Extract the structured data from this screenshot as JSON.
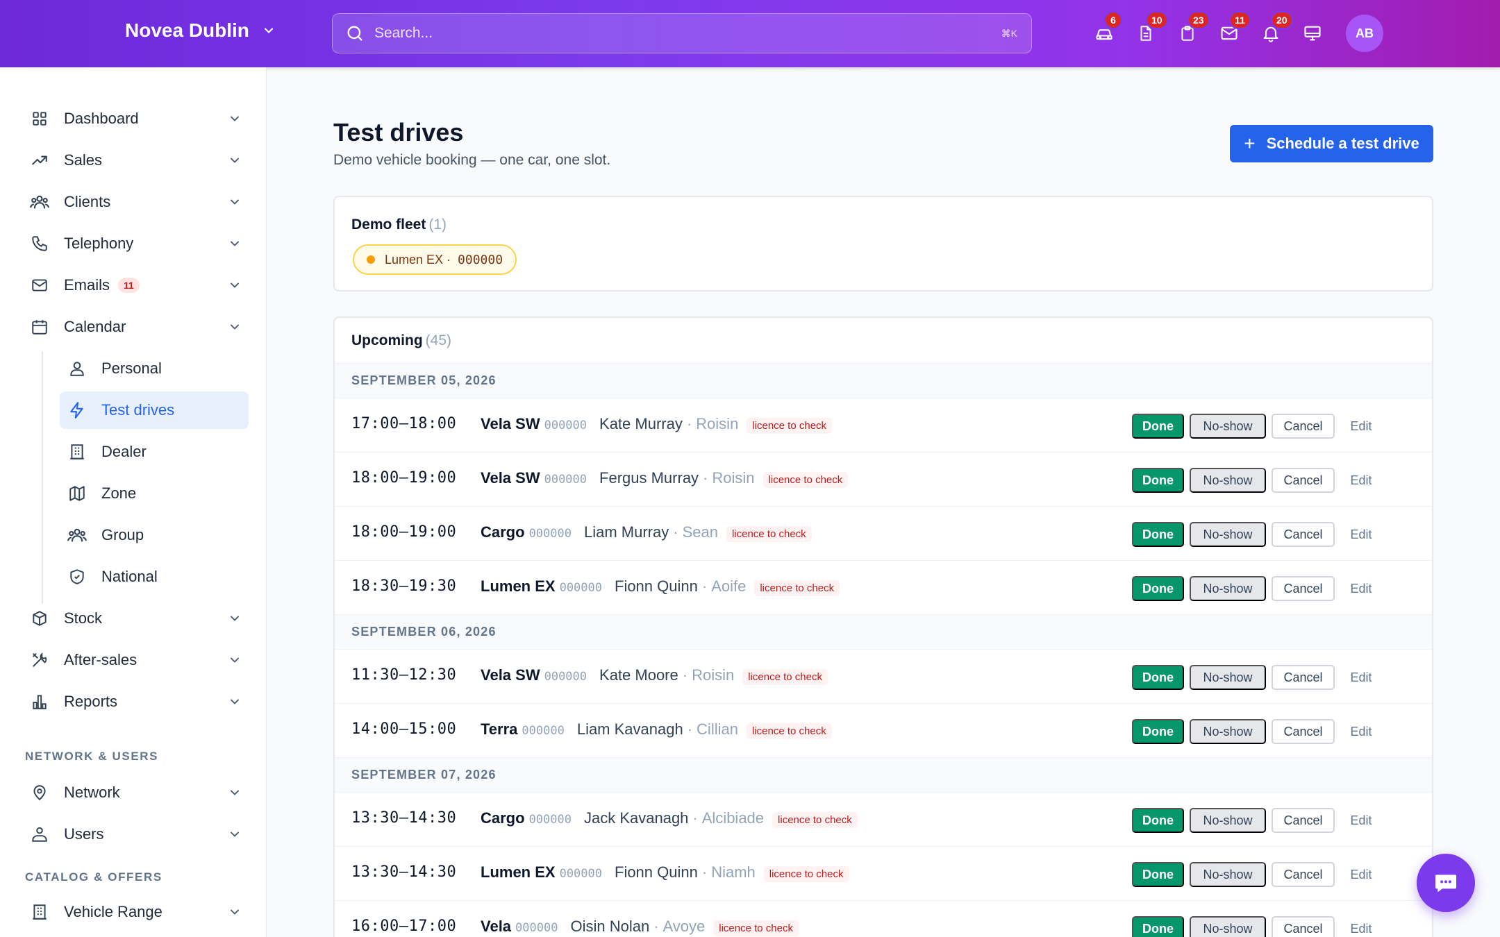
{
  "header": {
    "brand": "Novea Dublin",
    "search_placeholder": "Search...",
    "search_shortcut": "⌘K",
    "avatar_initials": "AB",
    "icons": [
      {
        "name": "car-icon",
        "count": "6"
      },
      {
        "name": "document-icon",
        "count": "10"
      },
      {
        "name": "clipboard-icon",
        "count": "23"
      },
      {
        "name": "mail-icon",
        "count": "11"
      },
      {
        "name": "bell-icon",
        "count": "20"
      },
      {
        "name": "monitor-icon",
        "count": null
      }
    ]
  },
  "sidebar": {
    "items": [
      {
        "label": "Dashboard",
        "icon": "grid-icon"
      },
      {
        "label": "Sales",
        "icon": "trending-up-icon"
      },
      {
        "label": "Clients",
        "icon": "users-icon"
      },
      {
        "label": "Telephony",
        "icon": "phone-icon"
      },
      {
        "label": "Emails",
        "icon": "mail-icon",
        "count": "11"
      },
      {
        "label": "Calendar",
        "icon": "calendar-icon"
      }
    ],
    "calendar_sub": [
      {
        "label": "Personal",
        "icon": "user-icon"
      },
      {
        "label": "Test drives",
        "icon": "bolt-icon",
        "active": true
      },
      {
        "label": "Dealer",
        "icon": "building-icon"
      },
      {
        "label": "Zone",
        "icon": "map-icon"
      },
      {
        "label": "Group",
        "icon": "group-icon"
      },
      {
        "label": "National",
        "icon": "shield-icon"
      }
    ],
    "items2": [
      {
        "label": "Stock",
        "icon": "box-icon"
      },
      {
        "label": "After-sales",
        "icon": "tools-icon"
      },
      {
        "label": "Reports",
        "icon": "bar-chart-icon"
      }
    ],
    "section_network": "NETWORK & USERS",
    "network_items": [
      {
        "label": "Network",
        "icon": "map-pin-icon"
      },
      {
        "label": "Users",
        "icon": "user-cog-icon"
      }
    ],
    "section_catalog": "CATALOG & OFFERS",
    "catalog_items": [
      {
        "label": "Vehicle Range",
        "icon": "building-icon"
      }
    ]
  },
  "page": {
    "title": "Test drives",
    "subtitle": "Demo vehicle booking — one car, one slot.",
    "primary_button": "Schedule a test drive"
  },
  "fleet": {
    "title": "Demo fleet",
    "count": "(1)",
    "vehicle": "Lumen EX ·",
    "plate": "000000",
    "status_color": "#f59e0b"
  },
  "upcoming": {
    "title": "Upcoming",
    "count": "(45)",
    "actions": {
      "done": "Done",
      "noshow": "No-show",
      "cancel": "Cancel",
      "edit": "Edit"
    },
    "groups": [
      {
        "date": "SEPTEMBER 05, 2026",
        "rows": [
          {
            "time": "17:00–18:00",
            "model": "Vela SW",
            "plate": "000000",
            "client": "Kate Murray",
            "advisor": "Roisin",
            "tag": "licence to check"
          },
          {
            "time": "18:00–19:00",
            "model": "Vela SW",
            "plate": "000000",
            "client": "Fergus Murray",
            "advisor": "Roisin",
            "tag": "licence to check"
          },
          {
            "time": "18:00–19:00",
            "model": "Cargo",
            "plate": "000000",
            "client": "Liam Murray",
            "advisor": "Sean",
            "tag": "licence to check"
          },
          {
            "time": "18:30–19:30",
            "model": "Lumen EX",
            "plate": "000000",
            "client": "Fionn Quinn",
            "advisor": "Aoife",
            "tag": "licence to check"
          }
        ]
      },
      {
        "date": "SEPTEMBER 06, 2026",
        "rows": [
          {
            "time": "11:30–12:30",
            "model": "Vela SW",
            "plate": "000000",
            "client": "Kate Moore",
            "advisor": "Roisin",
            "tag": "licence to check"
          },
          {
            "time": "14:00–15:00",
            "model": "Terra",
            "plate": "000000",
            "client": "Liam Kavanagh",
            "advisor": "Cillian",
            "tag": "licence to check"
          }
        ]
      },
      {
        "date": "SEPTEMBER 07, 2026",
        "rows": [
          {
            "time": "13:30–14:30",
            "model": "Cargo",
            "plate": "000000",
            "client": "Jack Kavanagh",
            "advisor": "Alcibiade",
            "tag": "licence to check"
          },
          {
            "time": "13:30–14:30",
            "model": "Lumen EX",
            "plate": "000000",
            "client": "Fionn Quinn",
            "advisor": "Niamh",
            "tag": "licence to check"
          },
          {
            "time": "16:00–17:00",
            "model": "Vela",
            "plate": "000000",
            "client": "Oisin Nolan",
            "advisor": "Avoye",
            "tag": "licence to check"
          }
        ]
      }
    ]
  },
  "colors": {
    "accent": "#2563eb",
    "brand_gradient_start": "#6d28d9",
    "brand_gradient_end": "#a21caf",
    "done": "#059669",
    "alert": "#dc2626"
  }
}
